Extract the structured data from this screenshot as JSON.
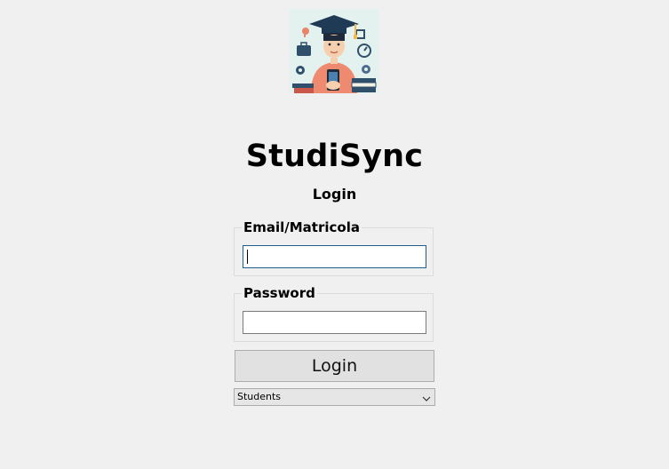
{
  "app": {
    "title": "StudiSync",
    "subtitle": "Login"
  },
  "form": {
    "email_label": "Email/Matricola",
    "email_value": "",
    "password_label": "Password",
    "password_value": "",
    "login_label": "Login",
    "role_selected": "Students"
  },
  "icons": {
    "logo": "student-graduate-logo-icon",
    "dropdown": "chevron-down-icon"
  },
  "colors": {
    "background": "#f0f0f0",
    "focus_border": "#1e5f8a",
    "button_bg": "#e1e1e1"
  }
}
